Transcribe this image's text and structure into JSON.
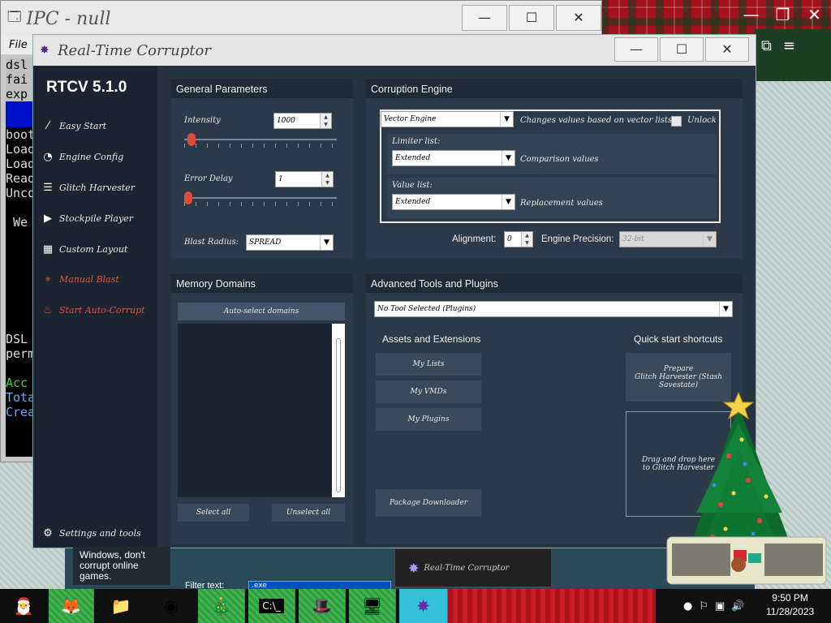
{
  "background_window": {
    "title": "IPC - null",
    "menu": "File",
    "console_lines": [
      "dsl",
      "fai",
      "exp",
      "",
      "boot",
      "Load",
      "Load",
      "Read",
      "Unco",
      "",
      " We",
      "",
      "",
      "",
      "",
      "",
      "",
      "",
      "DSL",
      "perm",
      "",
      "Acc",
      "Tota",
      "Crea"
    ]
  },
  "rtc_window": {
    "title": "Real-Time Corruptor",
    "version": "RTCV 5.1.0"
  },
  "sidebar": {
    "items": [
      {
        "label": "Easy Start",
        "icon": "wand-icon"
      },
      {
        "label": "Engine Config",
        "icon": "gauge-icon"
      },
      {
        "label": "Glitch Harvester",
        "icon": "layers-icon"
      },
      {
        "label": "Stockpile Player",
        "icon": "play-icon"
      },
      {
        "label": "Custom Layout",
        "icon": "grid-icon"
      },
      {
        "label": "Manual Blast",
        "icon": "crosshair-icon"
      },
      {
        "label": "Start Auto-Corrupt",
        "icon": "flame-icon"
      }
    ],
    "settings_label": "Settings and tools"
  },
  "general_parameters": {
    "title": "General Parameters",
    "intensity_label": "Intensity",
    "intensity_value": "1000",
    "intensity_level": 0.02,
    "error_delay_label": "Error Delay",
    "error_delay_value": "1",
    "error_delay_level": 0.0,
    "blast_radius_label": "Blast Radius:",
    "blast_radius_value": "SPREAD"
  },
  "corruption_engine": {
    "title": "Corruption Engine",
    "engine_value": "Vector Engine",
    "engine_desc": "Changes values based on vector lists",
    "unlock_label": "Unlock",
    "limiter_label": "Limiter list:",
    "limiter_value": "Extended",
    "limiter_desc": "Comparison values",
    "value_label": "Value list:",
    "value_value": "Extended",
    "value_desc": "Replacement values",
    "alignment_label": "Alignment:",
    "alignment_value": "0",
    "precision_label": "Engine Precision:",
    "precision_value": "32-bit"
  },
  "memory_domains": {
    "title": "Memory Domains",
    "autoselect_label": "Auto-select domains",
    "select_all_label": "Select all",
    "unselect_all_label": "Unselect all"
  },
  "advanced_tools": {
    "title": "Advanced Tools and Plugins",
    "tool_select_value": "No Tool Selected (Plugins)",
    "assets_title": "Assets and Extensions",
    "quick_title": "Quick start shortcuts",
    "my_lists_label": "My Lists",
    "my_vmds_label": "My VMDs",
    "my_plugins_label": "My Plugins",
    "package_label": "Package Downloader",
    "prepare_label_1": "Prepare",
    "prepare_label_2": "Glitch Harvester (Stash Savestate)",
    "drop_label_1": "Drag and drop here",
    "drop_label_2": "to Glitch Harvester"
  },
  "toast": {
    "text": "Windows, don't corrupt online games."
  },
  "filter": {
    "label": "Filter text:",
    "value": ".exe"
  },
  "taskbar_popup": {
    "title": "Real-Time Corruptor"
  },
  "clock": {
    "time": "9:50 PM",
    "date": "11/28/2023"
  },
  "colors": {
    "accent_red": "#e04a3a",
    "sidebar_bg": "#1b2430",
    "panel_bg": "#2b3948"
  }
}
